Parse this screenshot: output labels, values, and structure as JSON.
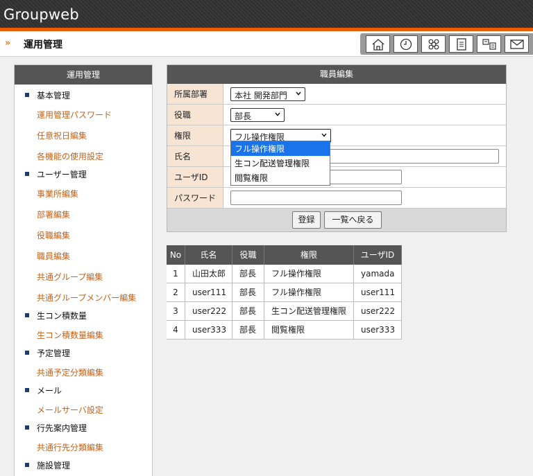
{
  "app": {
    "title": "Groupweb"
  },
  "header": {
    "section_title": "運用管理"
  },
  "toolbar": {
    "icons": [
      "home-icon",
      "clock-icon",
      "group-icon",
      "memo-icon",
      "users-icon",
      "mail-icon"
    ]
  },
  "sidebar": {
    "title": "運用管理",
    "sections": [
      {
        "label": "基本管理",
        "items": [
          "運用管理パスワード",
          "任意祝日編集",
          "各機能の使用設定"
        ]
      },
      {
        "label": "ユーザー管理",
        "items": [
          "事業所編集",
          "部署編集",
          "役職編集",
          "職員編集",
          "共通グループ編集",
          "共通グループメンバー編集"
        ]
      },
      {
        "label": "生コン積数量",
        "items": [
          "生コン積数量編集"
        ]
      },
      {
        "label": "予定管理",
        "items": [
          "共通予定分類編集"
        ]
      },
      {
        "label": "メール",
        "items": [
          "メールサーバ設定"
        ]
      },
      {
        "label": "行先案内管理",
        "items": [
          "共通行先分類編集"
        ]
      },
      {
        "label": "施設管理",
        "items": []
      }
    ]
  },
  "form": {
    "title": "職員編集",
    "fields": {
      "department": {
        "label": "所属部署",
        "value": "本社 開発部門"
      },
      "position": {
        "label": "役職",
        "value": "部長"
      },
      "permission": {
        "label": "権限",
        "value": "フル操作権限"
      },
      "name": {
        "label": "氏名",
        "value": ""
      },
      "userid": {
        "label": "ユーザID",
        "value": ""
      },
      "password": {
        "label": "パスワード",
        "value": ""
      }
    },
    "permission_options": [
      "フル操作権限",
      "生コン配送管理権限",
      "閲覧権限"
    ],
    "buttons": {
      "register": "登録",
      "back": "一覧へ戻る"
    }
  },
  "table": {
    "headers": [
      "No",
      "氏名",
      "役職",
      "権限",
      "ユーザID"
    ],
    "rows": [
      [
        "1",
        "山田太郎",
        "部長",
        "フル操作権限",
        "yamada"
      ],
      [
        "2",
        "user111",
        "部長",
        "フル操作権限",
        "user111"
      ],
      [
        "3",
        "user222",
        "部長",
        "生コン配送管理権限",
        "user222"
      ],
      [
        "4",
        "user333",
        "部長",
        "閲覧権限",
        "user333"
      ]
    ]
  },
  "colors": {
    "accent": "#ee5a00",
    "link": "#c0641d",
    "header_bg": "#555555",
    "label_bg": "#f7e4d3",
    "selected": "#1a73e8"
  }
}
